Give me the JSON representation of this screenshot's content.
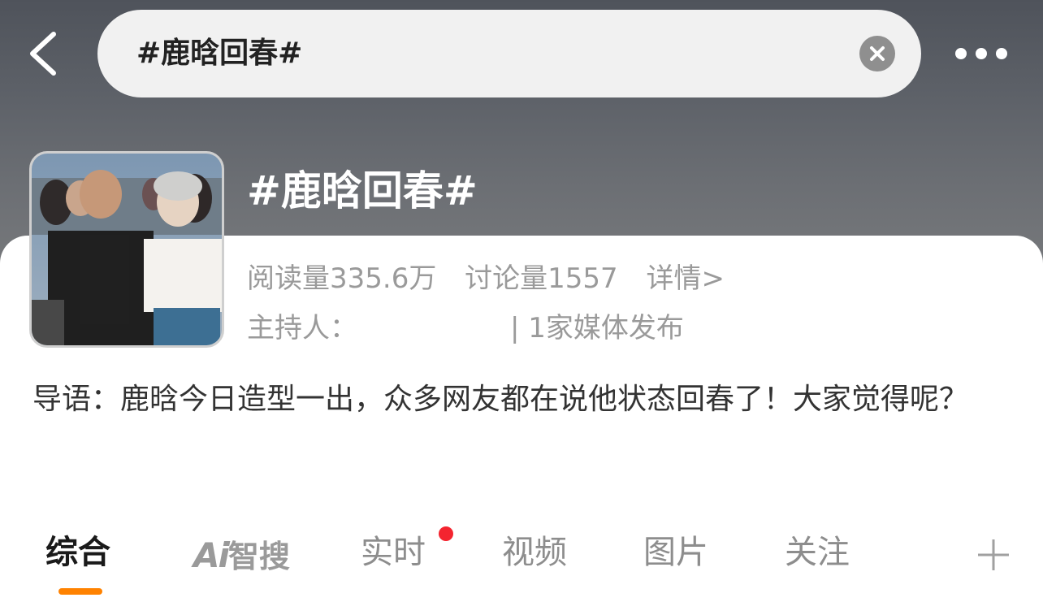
{
  "header": {
    "search_text": "#鹿晗回春#",
    "back_icon": "chevron-left-icon",
    "clear_icon": "close-icon",
    "more_icon": "more-dots-icon"
  },
  "topic": {
    "title": "#鹿晗回春#",
    "reads": "阅读量335.6万",
    "discussions": "讨论量1557",
    "detail_link": "详情>",
    "host_label": "主持人：",
    "media": "| 1家媒体发布",
    "intro": "导语：鹿晗今日造型一出，众多网友都在说他状态回春了！大家觉得呢？"
  },
  "tabs": {
    "items": [
      "综合",
      "智搜",
      "实时",
      "视频",
      "图片",
      "关注"
    ],
    "ai_mark": "Ai",
    "active": "综合",
    "plus_icon": "plus-icon"
  },
  "colors": {
    "accent": "#ff8200",
    "notify_dot": "#f4242f",
    "hero_bg": "#5d6168"
  }
}
